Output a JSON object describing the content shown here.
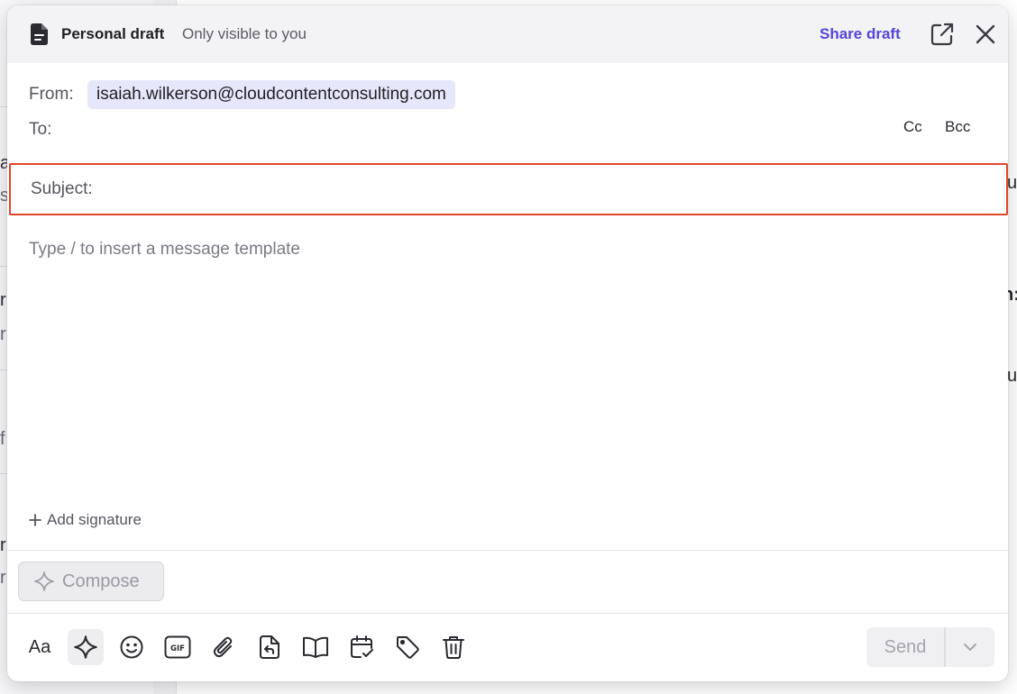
{
  "header": {
    "title": "Personal draft",
    "subtitle": "Only visible to you",
    "share_label": "Share draft"
  },
  "fields": {
    "from_label": "From:",
    "from_value": "isaiah.wilkerson@cloudcontentconsulting.com",
    "to_label": "To:",
    "cc_label": "Cc",
    "bcc_label": "Bcc",
    "subject_label": "Subject:",
    "subject_value": ""
  },
  "body": {
    "placeholder": "Type / to insert a message template"
  },
  "footer": {
    "add_signature_label": "Add signature",
    "compose_label": "Compose",
    "format_label": "Aa",
    "send_label": "Send"
  },
  "icons": {
    "doc": "document-icon",
    "popout": "popout-icon",
    "close": "close-icon",
    "sparkle": "sparkle-icon",
    "emoji": "emoji-icon",
    "gif": "gif-icon",
    "attach": "paperclip-icon",
    "template": "insert-template-icon",
    "book": "book-icon",
    "schedule": "calendar-check-icon",
    "tag": "tag-icon",
    "trash": "trash-icon",
    "chevron": "chevron-down-icon"
  },
  "colors": {
    "accent": "#5446d8",
    "highlight_border": "#e2462a",
    "chip_bg": "#e7e7fb"
  },
  "background_text": {
    "g1": "a",
    "g2": "s",
    "g3": "u",
    "g4": "r",
    "g5": "r",
    "g6": "n:",
    "g7": "f",
    "g8": "u",
    "g9": "r",
    "g10": "r"
  }
}
